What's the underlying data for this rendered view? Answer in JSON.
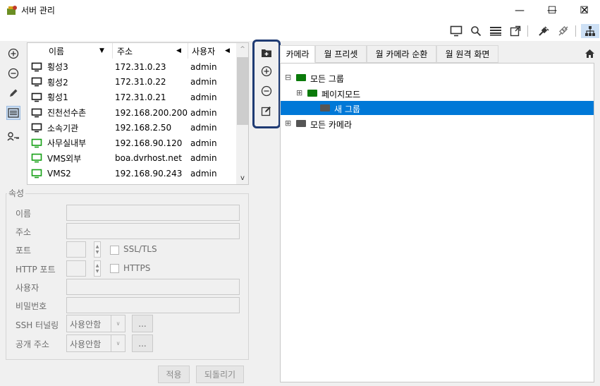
{
  "window": {
    "title": "서버 관리",
    "controls": {
      "minimize": "—",
      "maximize": "☐",
      "close": "✕"
    }
  },
  "toolbar": {
    "icons": [
      "monitor-icon",
      "search-icon",
      "list-icon",
      "external-window-icon",
      "plug-icon",
      "disconnect-icon",
      "network-icon"
    ]
  },
  "server_list": {
    "columns": [
      {
        "label": "이름",
        "sort": "▼"
      },
      {
        "label": "주소",
        "sort": "◀"
      },
      {
        "label": "사용자",
        "sort": "◀"
      }
    ],
    "rows": [
      {
        "name": "횡성3",
        "address": "172.31.0.23",
        "user": "admin",
        "icon_color": "#1a1a1a"
      },
      {
        "name": "횡성2",
        "address": "172.31.0.22",
        "user": "admin",
        "icon_color": "#1a1a1a"
      },
      {
        "name": "횡성1",
        "address": "172.31.0.21",
        "user": "admin",
        "icon_color": "#1a1a1a"
      },
      {
        "name": "진천선수촌",
        "address": "192.168.200.200",
        "user": "admin",
        "icon_color": "#1a1a1a"
      },
      {
        "name": "소속기관",
        "address": "192.168.2.50",
        "user": "admin",
        "icon_color": "#1a1a1a"
      },
      {
        "name": "사무실내부",
        "address": "192.168.90.120",
        "user": "admin",
        "icon_color": "#15a015"
      },
      {
        "name": "VMS외부",
        "address": "boa.dvrhost.net",
        "user": "admin",
        "icon_color": "#15a015"
      },
      {
        "name": "VMS2",
        "address": "192.168.90.243",
        "user": "admin",
        "icon_color": "#15a015"
      }
    ]
  },
  "properties": {
    "legend": "속성",
    "name_label": "이름",
    "address_label": "주소",
    "port_label": "포트",
    "ssl_label": "SSL/TLS",
    "http_port_label": "HTTP 포트",
    "https_label": "HTTPS",
    "user_label": "사용자",
    "password_label": "비밀번호",
    "ssh_label": "SSH 터널링",
    "ssh_value": "사용안함",
    "public_label": "공개 주소",
    "public_value": "사용안함",
    "dots": "...",
    "apply": "적용",
    "revert": "되돌리기"
  },
  "tabs": [
    "카메라",
    "월 프리셋",
    "월 카메라 순환",
    "월 원격 화면"
  ],
  "tree": [
    {
      "label": "모든 그룹",
      "expander": "⊟",
      "folder_color": "#0a7a0a",
      "selected": false
    },
    {
      "label": "페이지모드",
      "expander": "⊞",
      "folder_color": "#0a7a0a",
      "selected": false
    },
    {
      "label": "새 그룹",
      "expander": "",
      "folder_color": "#555555",
      "selected": true
    },
    {
      "label": "모든 카메라",
      "expander": "⊞",
      "folder_color": "#555555",
      "selected": false
    }
  ],
  "colors": {
    "selection": "#0078d7",
    "highlight_border": "#1f3b73"
  }
}
